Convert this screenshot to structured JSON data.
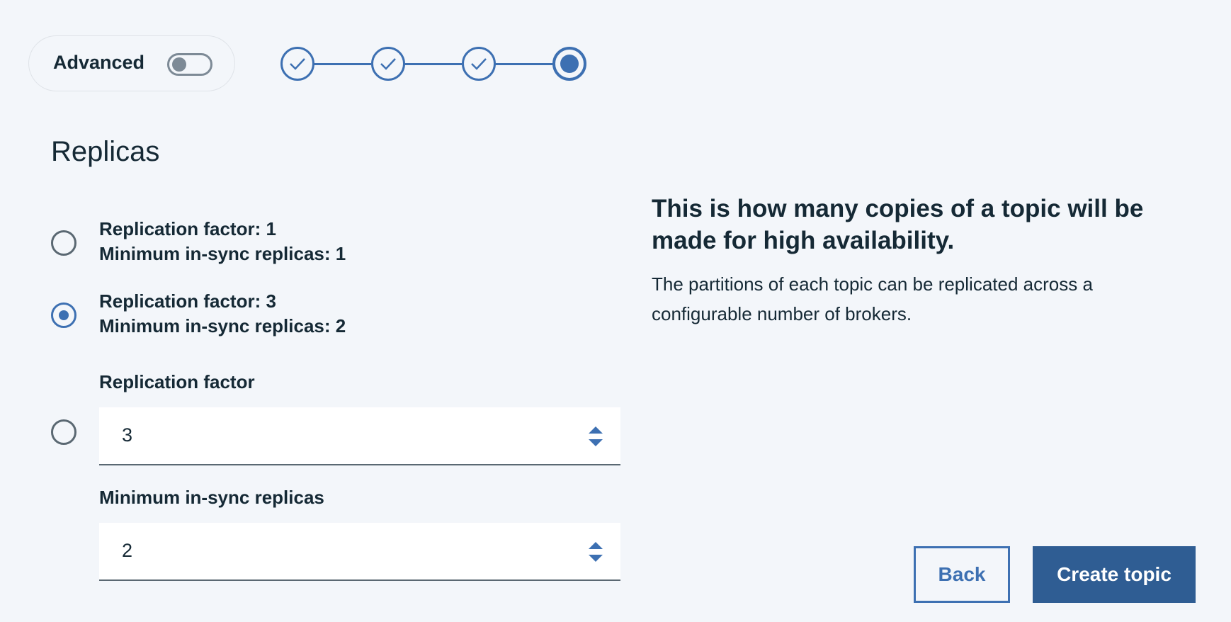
{
  "header": {
    "advanced_label": "Advanced",
    "advanced_toggle_on": false,
    "steps": [
      {
        "state": "complete",
        "icon": "checkmark-icon"
      },
      {
        "state": "complete",
        "icon": "checkmark-icon"
      },
      {
        "state": "complete",
        "icon": "checkmark-icon"
      },
      {
        "state": "current",
        "icon": "current-step-icon"
      }
    ]
  },
  "section": {
    "title": "Replicas"
  },
  "options": [
    {
      "line1": "Replication factor: 1",
      "line2": "Minimum in-sync replicas: 1",
      "selected": false
    },
    {
      "line1": "Replication factor: 3",
      "line2": "Minimum in-sync replicas: 2",
      "selected": true
    }
  ],
  "custom": {
    "selected": false,
    "replication_factor_label": "Replication factor",
    "replication_factor_value": "3",
    "min_isr_label": "Minimum in-sync replicas",
    "min_isr_value": "2"
  },
  "info": {
    "heading": "This is how many copies of a topic will be made for high availability.",
    "body": "The partitions of each topic can be replicated across a configurable number of brokers."
  },
  "actions": {
    "back_label": "Back",
    "create_label": "Create topic"
  },
  "colors": {
    "accent": "#3d70b2",
    "primary_button": "#2f5d93",
    "background": "#f3f6fa",
    "text": "#152935"
  }
}
